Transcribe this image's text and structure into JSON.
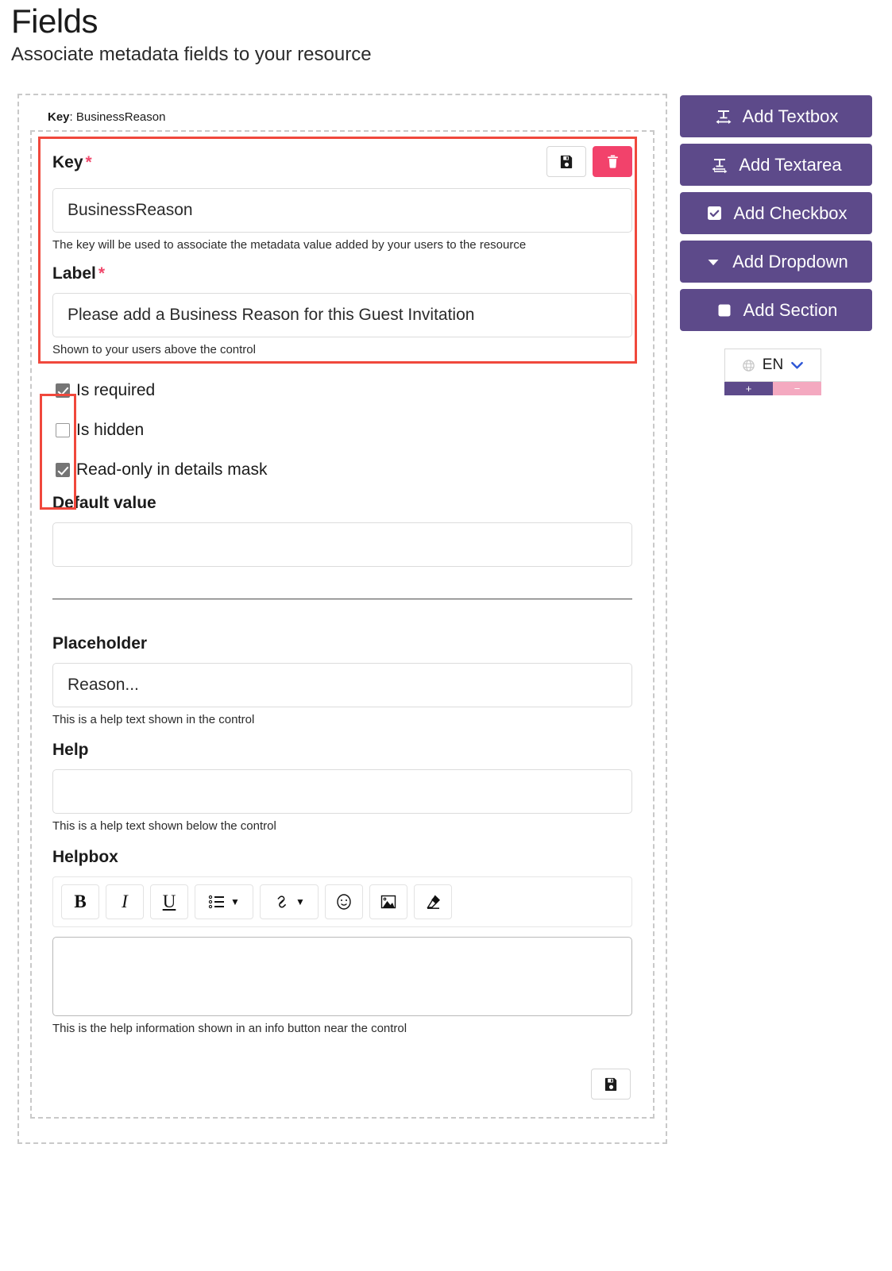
{
  "header": {
    "title": "Fields",
    "subtitle": "Associate metadata fields to your resource"
  },
  "field_card": {
    "key_summary_prefix": "Key",
    "key_summary_separator": ": ",
    "key_summary_value": "BusinessReason",
    "key_label": "Key",
    "required_marker": "*",
    "key_value": "BusinessReason",
    "key_hint": "The key will be used to associate the metadata value added by your users to the resource",
    "label_label": "Label",
    "label_value": "Please add a Business Reason for this Guest Invitation",
    "label_hint": "Shown to your users above the control",
    "save_icon": "floppy-disk-icon",
    "delete_icon": "trash-icon",
    "checkboxes": [
      {
        "label": "Is required",
        "checked": true
      },
      {
        "label": "Is hidden",
        "checked": false
      },
      {
        "label": "Read-only in details mask",
        "checked": true
      }
    ],
    "default_value_label": "Default value",
    "default_value": "",
    "placeholder_label": "Placeholder",
    "placeholder_value": "Reason...",
    "placeholder_hint": "This is a help text shown in the control",
    "help_label": "Help",
    "help_value": "",
    "help_hint": "This is a help text shown below the control",
    "helpbox_label": "Helpbox",
    "helpbox_value": "",
    "helpbox_hint": "This is the help information shown in an info button near the control",
    "bottom_save_icon": "floppy-disk-icon"
  },
  "editor_toolbar": {
    "buttons": [
      {
        "name": "bold",
        "glyph": "B",
        "has_caret": false
      },
      {
        "name": "italic",
        "glyph": "I",
        "has_caret": false
      },
      {
        "name": "underline",
        "glyph": "U",
        "has_caret": false
      },
      {
        "name": "list",
        "glyph": "",
        "has_caret": true
      },
      {
        "name": "link",
        "glyph": "",
        "has_caret": true
      },
      {
        "name": "emoji",
        "glyph": "",
        "has_caret": false
      },
      {
        "name": "image",
        "glyph": "",
        "has_caret": false
      },
      {
        "name": "clear-format",
        "glyph": "",
        "has_caret": false
      }
    ]
  },
  "sidebar": {
    "buttons": [
      {
        "label": "Add Textbox",
        "icon": "textbox-icon"
      },
      {
        "label": "Add Textarea",
        "icon": "textarea-icon"
      },
      {
        "label": "Add Checkbox",
        "icon": "checkbox-icon"
      },
      {
        "label": "Add Dropdown",
        "icon": "caret-down-icon"
      },
      {
        "label": "Add Section",
        "icon": "square-icon"
      }
    ],
    "language": {
      "icon": "globe-icon",
      "value": "EN",
      "chevron": "chevron-down-icon",
      "add_label": "+",
      "remove_label": "−"
    }
  },
  "colors": {
    "purple": "#5d4a8a",
    "danger_pink": "#f2426b",
    "highlight_red": "#f0483c",
    "pink_light": "#f4a9c0",
    "required_star": "#f0486b"
  }
}
